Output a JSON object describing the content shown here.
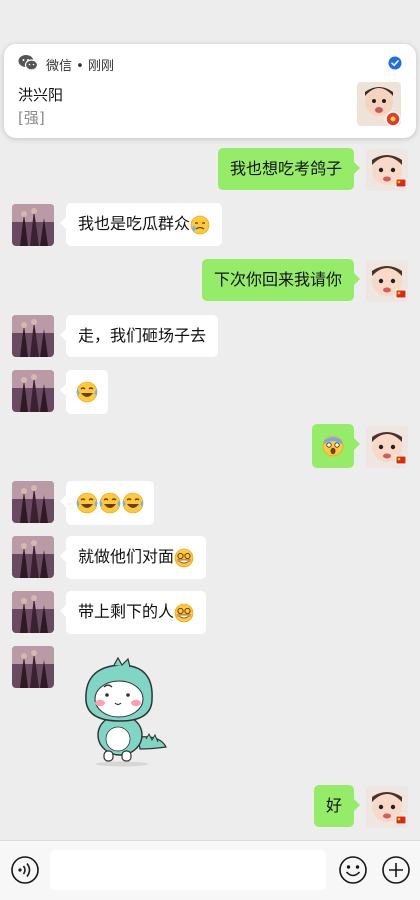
{
  "notification": {
    "app_name": "微信",
    "separator": "•",
    "time": "刚刚",
    "sender": "洪兴阳",
    "preview": "[强]",
    "app_icon": "wechat-icon",
    "verified_icon": "verified-badge-icon"
  },
  "messages": [
    {
      "side": "right",
      "text": "我也想吃考鸽子"
    },
    {
      "side": "left",
      "text": "我也是吃瓜群众",
      "emoji": "tear-face"
    },
    {
      "side": "right",
      "text": "下次你回来我请你"
    },
    {
      "side": "left",
      "text": "走，我们砸场子去"
    },
    {
      "side": "left",
      "text": "",
      "emoji": "laugh-tears"
    },
    {
      "side": "right",
      "text": "",
      "emoji": "scream-face"
    },
    {
      "side": "left",
      "text": "",
      "emoji": "laugh-tears x3"
    },
    {
      "side": "left",
      "text": "就做他们对面",
      "emoji": "grin-glasses"
    },
    {
      "side": "left",
      "text": "带上剩下的人",
      "emoji": "grin-glasses"
    },
    {
      "side": "left",
      "text": "",
      "sticker": "dinosaur-sticker"
    },
    {
      "side": "right",
      "text": "好"
    }
  ],
  "input_bar": {
    "voice_icon": "voice-icon",
    "emoji_icon": "emoji-icon",
    "plus_icon": "plus-icon",
    "input_value": ""
  },
  "colors": {
    "background": "#ededed",
    "own_bubble": "#95ec69",
    "other_bubble": "#ffffff",
    "verified": "#1e6fe6"
  }
}
